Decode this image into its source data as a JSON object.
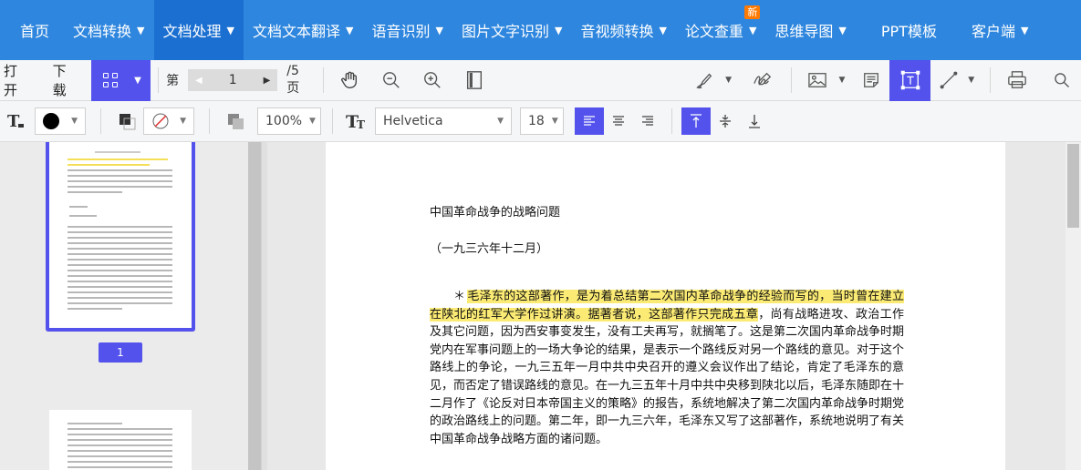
{
  "nav": {
    "items": [
      {
        "label": "首页",
        "caret": false
      },
      {
        "label": "文档转换",
        "caret": true
      },
      {
        "label": "文档处理",
        "caret": true
      },
      {
        "label": "文档文本翻译",
        "caret": true
      },
      {
        "label": "语音识别",
        "caret": true
      },
      {
        "label": "图片文字识别",
        "caret": true
      },
      {
        "label": "音视频转换",
        "caret": true
      },
      {
        "label": "论文查重",
        "caret": true
      },
      {
        "label": "思维导图",
        "caret": true
      },
      {
        "label": "PPT模板",
        "caret": false
      },
      {
        "label": "客户端",
        "caret": true
      }
    ],
    "active_index": 2,
    "badge_label": "新",
    "badge_item_index": 7,
    "background_color": "#2e86de",
    "active_color": "#1a6fd1",
    "badge_color": "#ff7a00"
  },
  "toolbar": {
    "open_label": "打开",
    "download_label": "下载",
    "page_prefix": "第",
    "current_page": "1",
    "page_total": "/5 页",
    "accent_color": "#5352ed",
    "icons": [
      "grid-icon",
      "hand-icon",
      "zoom-out-icon",
      "zoom-in-icon",
      "fit-page-icon",
      "pen-icon",
      "signature-icon",
      "image-icon",
      "note-icon",
      "text-box-icon",
      "line-icon",
      "print-icon",
      "search-icon"
    ]
  },
  "format_bar": {
    "zoom_value": "100%",
    "font_family": "Helvetica",
    "font_size": "18",
    "icons": [
      "text-color-icon",
      "fill-color-icon",
      "border-color-icon",
      "no-color-icon",
      "opacity-icon",
      "font-size-icon",
      "align-left-icon",
      "align-center-icon",
      "align-right-icon",
      "valign-top-icon",
      "valign-middle-icon",
      "valign-bottom-icon"
    ]
  },
  "sidebar": {
    "page_badge": "1"
  },
  "document": {
    "title": "中国革命战争的战略问题",
    "date": "（一九三六年十二月）",
    "para_prefix": "＊",
    "para_hl1": "毛泽东的这部著作，是为着总结第二次国内革命战争的经验而写的，当时曾在建立在陕北的红军大学作过讲演。",
    "para_hl2": "据著者说，这部著作只完成五章",
    "para_rest": "，尚有战略进攻、政治工作及其它问题，因为西安事变发生，没有工夫再写，就搁笔了。这是第二次国内革命战争时期党内在军事问题上的一场大争论的结果，是表示一个路线反对另一个路线的意见。对于这个路线上的争论，一九三五年一月中共中央召开的遵义会议作出了结论，肯定了毛泽东的意见，而否定了错误路线的意见。在一九三五年十月中共中央移到陕北以后，毛泽东随即在十二月作了《论反对日本帝国主义的策略》的报告，系统地解决了第二次国内革命战争时期党的政治路线上的问题。第二年，即一九三六年，毛泽东又写了这部著作，系统地说明了有关中国革命战争战略方面的诸问题。",
    "highlight_color": "#fbeb74"
  }
}
